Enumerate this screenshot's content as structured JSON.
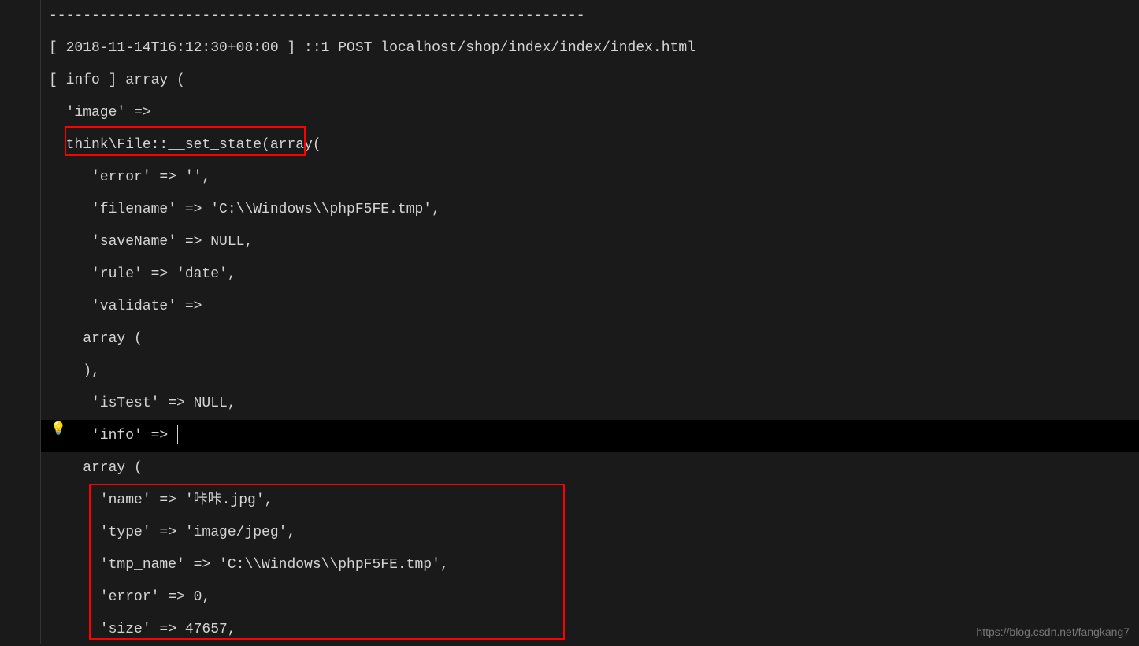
{
  "lines": {
    "l0": "---------------------------------------------------------------",
    "l1": "[ 2018-11-14T16:12:30+08:00 ] ::1 POST localhost/shop/index/index/index.html",
    "l2": "[ info ] array (",
    "l3": "  'image' => ",
    "l4": "  think\\File::__set_state(array(",
    "l5": "     'error' => '',",
    "l6": "     'filename' => 'C:\\\\Windows\\\\phpF5FE.tmp',",
    "l7": "     'saveName' => NULL,",
    "l8": "     'rule' => 'date',",
    "l9": "     'validate' => ",
    "l10": "    array (",
    "l11": "    ),",
    "l12": "     'isTest' => NULL,",
    "l13": "     'info' => ",
    "l14": "    array (",
    "l15": "      'name' => '咔咔.jpg',",
    "l16": "      'type' => 'image/jpeg',",
    "l17": "      'tmp_name' => 'C:\\\\Windows\\\\phpF5FE.tmp',",
    "l18": "      'error' => 0,",
    "l19": "      'size' => 47657,"
  },
  "bulb_icon": "💡",
  "watermark": "https://blog.csdn.net/fangkang7"
}
